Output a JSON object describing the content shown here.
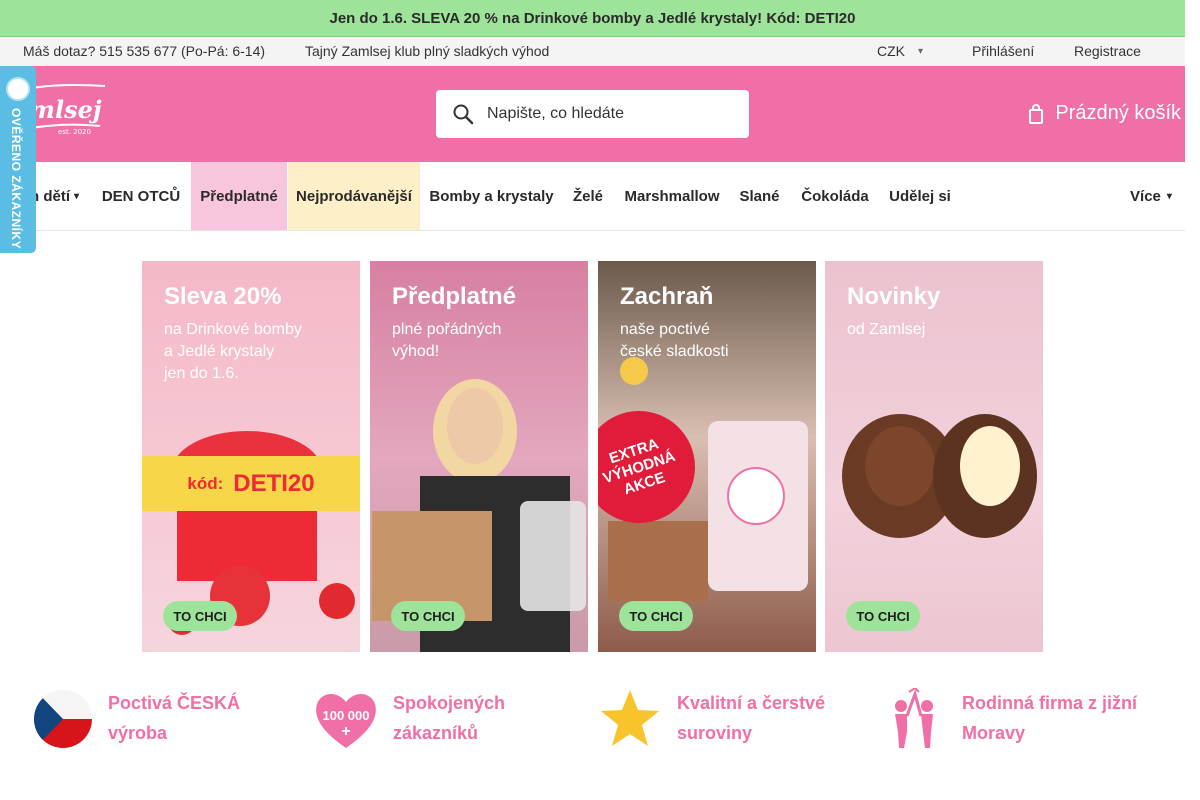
{
  "promo": {
    "text": "Jen do 1.6. SLEVA 20 % na Drinkové bomby a Jedlé krystaly! Kód: DETI20"
  },
  "topbar": {
    "contact": "Máš dotaz? 515 535 677 (Po-Pá: 6-14)",
    "club": "Tajný Zamlsej klub  plný sladkých výhod",
    "currency": "CZK",
    "login": "Přihlášení",
    "register": "Registrace"
  },
  "header": {
    "logo_text": "Zamlsej",
    "logo_sub": "est. 2020",
    "search_placeholder": "Napište, co hledáte",
    "cart_label": "Prázdný košík"
  },
  "badge": {
    "text": "OVĚŘENO ZÁKAZNÍKY"
  },
  "nav": {
    "items": [
      "n dětí",
      "DEN OTCŮ",
      "Předplatné",
      "Nejprodávanější",
      "Bomby a krystaly",
      "Želé",
      "Marshmallow",
      "Slané",
      "Čokoláda",
      "Udělej si"
    ],
    "more": "Více"
  },
  "banners": [
    {
      "title": "Sleva 20%",
      "subtitle": "na Drinkové bomby\na Jedlé krystaly\njen do 1.6.",
      "code_label": "kód:",
      "code": "DETI20",
      "cta": "TO CHCI"
    },
    {
      "title": "Předplatné",
      "subtitle": "plné pořádných\nvýhod!",
      "cta": "TO CHCI"
    },
    {
      "title": "Zachraň",
      "subtitle": "naše poctivé\nčeské sladkosti",
      "sticker": "EXTRA\nVÝHODNÁ\nAKCE",
      "cta": "TO CHCI"
    },
    {
      "title": "Novinky",
      "subtitle": "od Zamlsej",
      "cta": "TO CHCI"
    }
  ],
  "features": [
    {
      "icon": "czech-flag-icon",
      "line1": "Poctivá ČESKÁ",
      "line2": "výroba"
    },
    {
      "icon": "heart-icon",
      "badge": "100 000",
      "line1": "Spokojených",
      "line2": "zákazníků"
    },
    {
      "icon": "star-icon",
      "line1": "Kvalitní a čerstvé",
      "line2": "suroviny"
    },
    {
      "icon": "family-icon",
      "line1": "Rodinná firma z jižní",
      "line2": "Moravy"
    }
  ],
  "colors": {
    "accent": "#f06fa6",
    "promo": "#9ee39a",
    "badge": "#5bbde3",
    "cta": "#9ee39a"
  }
}
